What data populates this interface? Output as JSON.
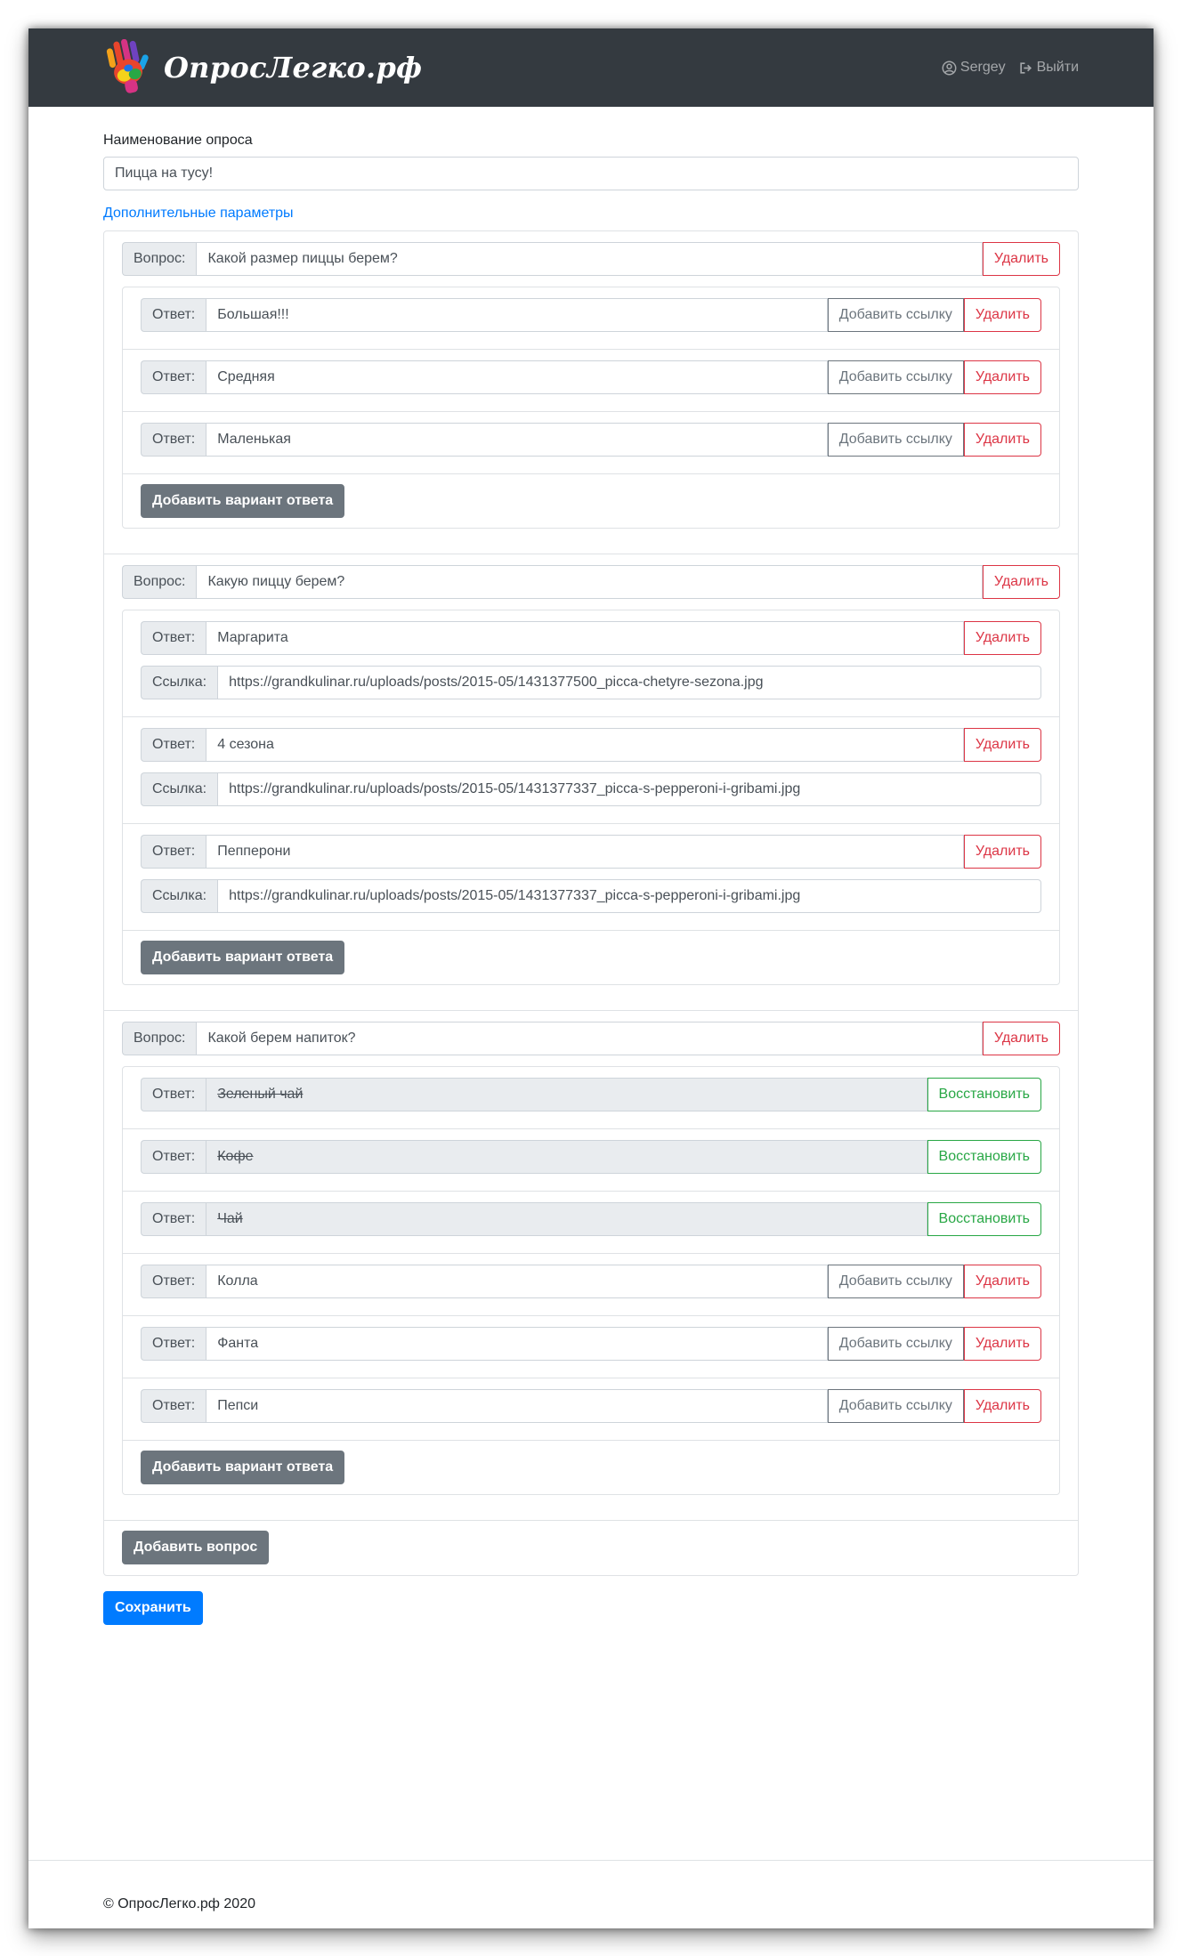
{
  "brand": {
    "name": "ОпросЛегко.рф"
  },
  "nav": {
    "user_label": "Sergey",
    "logout_label": "Выйти"
  },
  "form": {
    "survey_name_label": "Наименование опроса",
    "survey_name_value": "Пицца на тусу!",
    "extra_params_link": "Дополнительные параметры"
  },
  "labels": {
    "question": "Вопрос:",
    "answer": "Ответ:",
    "link": "Ссылка:",
    "delete": "Удалить",
    "add_link": "Добавить ссылку",
    "restore": "Восстановить",
    "add_answer": "Добавить вариант ответа",
    "add_question": "Добавить вопрос",
    "save": "Сохранить"
  },
  "questions": [
    {
      "text": "Какой размер пиццы берем?",
      "answers": [
        {
          "text": "Большая!!!"
        },
        {
          "text": "Средняя"
        },
        {
          "text": "Маленькая"
        }
      ]
    },
    {
      "text": "Какую пиццу берем?",
      "answers": [
        {
          "text": "Маргарита",
          "link": "https://grandkulinar.ru/uploads/posts/2015-05/1431377500_picca-chetyre-sezona.jpg"
        },
        {
          "text": "4 сезона",
          "link": "https://grandkulinar.ru/uploads/posts/2015-05/1431377337_picca-s-pepperoni-i-gribami.jpg"
        },
        {
          "text": "Пепперони",
          "link": "https://grandkulinar.ru/uploads/posts/2015-05/1431377337_picca-s-pepperoni-i-gribami.jpg"
        }
      ]
    },
    {
      "text": "Какой берем напиток?",
      "answers": [
        {
          "text": "Зеленый чай",
          "deleted": true
        },
        {
          "text": "Кофе",
          "deleted": true
        },
        {
          "text": "Чай",
          "deleted": true
        },
        {
          "text": "Колла"
        },
        {
          "text": "Фанта"
        },
        {
          "text": "Пепси"
        }
      ]
    }
  ],
  "footer": {
    "copyright": "© ОпросЛегко.рф 2020"
  }
}
